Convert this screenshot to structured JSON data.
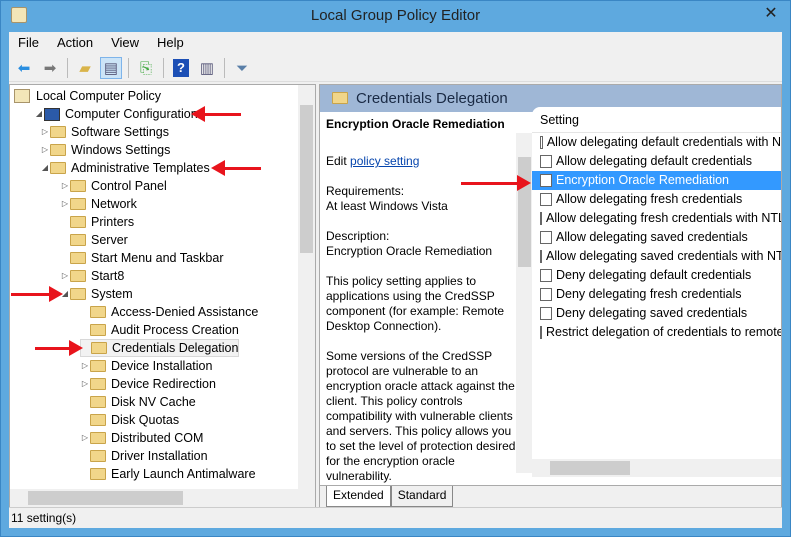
{
  "window": {
    "title": "Local Group Policy Editor",
    "close": "✕"
  },
  "menu": [
    "File",
    "Action",
    "View",
    "Help"
  ],
  "toolbar": {
    "icons": [
      "back-icon",
      "forward-icon",
      "up-folder-icon",
      "show-hide-tree-icon",
      "export-list-icon",
      "help-icon",
      "show-action-pane-icon",
      "filter-icon"
    ]
  },
  "tree": [
    {
      "label": "Local Computer Policy",
      "level": 0,
      "exp": ""
    },
    {
      "label": "Computer Configuration",
      "level": 1,
      "exp": "open"
    },
    {
      "label": "Software Settings",
      "level": 2,
      "exp": "closed"
    },
    {
      "label": "Windows Settings",
      "level": 2,
      "exp": "closed"
    },
    {
      "label": "Administrative Templates",
      "level": 2,
      "exp": "open"
    },
    {
      "label": "Control Panel",
      "level": 3,
      "exp": "closed"
    },
    {
      "label": "Network",
      "level": 3,
      "exp": "closed"
    },
    {
      "label": "Printers",
      "level": 3,
      "exp": ""
    },
    {
      "label": "Server",
      "level": 3,
      "exp": ""
    },
    {
      "label": "Start Menu and Taskbar",
      "level": 3,
      "exp": ""
    },
    {
      "label": "Start8",
      "level": 3,
      "exp": "closed"
    },
    {
      "label": "System",
      "level": 3,
      "exp": "open"
    },
    {
      "label": "Access-Denied Assistance",
      "level": 4,
      "exp": ""
    },
    {
      "label": "Audit Process Creation",
      "level": 4,
      "exp": ""
    },
    {
      "label": "Credentials Delegation",
      "level": 4,
      "exp": "",
      "selected": true
    },
    {
      "label": "Device Installation",
      "level": 4,
      "exp": "closed"
    },
    {
      "label": "Device Redirection",
      "level": 4,
      "exp": "closed"
    },
    {
      "label": "Disk NV Cache",
      "level": 4,
      "exp": ""
    },
    {
      "label": "Disk Quotas",
      "level": 4,
      "exp": ""
    },
    {
      "label": "Distributed COM",
      "level": 4,
      "exp": "closed"
    },
    {
      "label": "Driver Installation",
      "level": 4,
      "exp": ""
    },
    {
      "label": "Early Launch Antimalware",
      "level": 4,
      "exp": ""
    }
  ],
  "pane": {
    "header": "Credentials Delegation",
    "title": "Encryption Oracle Remediation",
    "edit_prefix": "Edit ",
    "edit_link": "policy setting",
    "req_label": "Requirements:",
    "req_value": "At least Windows Vista",
    "desc_label": "Description:",
    "desc_value": "Encryption Oracle Remediation",
    "para1": "This policy setting applies to applications using the CredSSP component (for example: Remote Desktop Connection).",
    "para2": "Some versions of the CredSSP protocol are vulnerable to an encryption oracle attack against the client.  This policy controls compatibility with vulnerable clients and servers.  This policy allows you to set the level of protection desired for the encryption oracle vulnerability."
  },
  "list": {
    "column": "Setting",
    "selected_index": 2,
    "items": [
      "Allow delegating default credentials with N",
      "Allow delegating default credentials",
      "Encryption Oracle Remediation",
      "Allow delegating fresh credentials",
      "Allow delegating fresh credentials with NTL",
      "Allow delegating saved credentials",
      "Allow delegating saved credentials with NT",
      "Deny delegating default credentials",
      "Deny delegating fresh credentials",
      "Deny delegating saved credentials",
      "Restrict delegation of credentials to remote"
    ]
  },
  "tabs": [
    "Extended",
    "Standard"
  ],
  "status": "11 setting(s)",
  "colors": {
    "frame": "#5ea9df",
    "selection": "#3399ff",
    "annotation_arrow": "#e8141c"
  }
}
